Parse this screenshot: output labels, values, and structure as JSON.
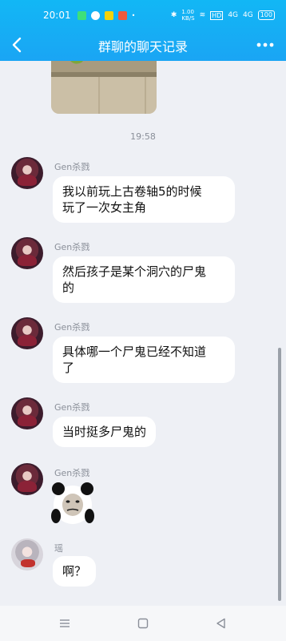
{
  "status_bar": {
    "time": "20:01",
    "speed": "1.00\nKB/S",
    "hd": "HD",
    "signal1": "4G",
    "signal2": "4G",
    "battery": "100"
  },
  "header": {
    "title": "群聊的聊天记录"
  },
  "timestamp": "19:58",
  "messages": [
    {
      "sender": "Gen杀戮",
      "text": "我以前玩上古卷轴5的时候\n玩了一次女主角"
    },
    {
      "sender": "Gen杀戮",
      "text": "然后孩子是某个洞穴的尸鬼\n的"
    },
    {
      "sender": "Gen杀戮",
      "text": "具体哪一个尸鬼已经不知道\n了"
    },
    {
      "sender": "Gen杀戮",
      "text": "当时挺多尸鬼的"
    },
    {
      "sender": "Gen杀戮",
      "text": ""
    },
    {
      "sender": "瑶",
      "text": "啊？"
    }
  ],
  "colors": {
    "header": "#12b7f5",
    "background": "#eef0f5",
    "bubble": "#ffffff"
  }
}
